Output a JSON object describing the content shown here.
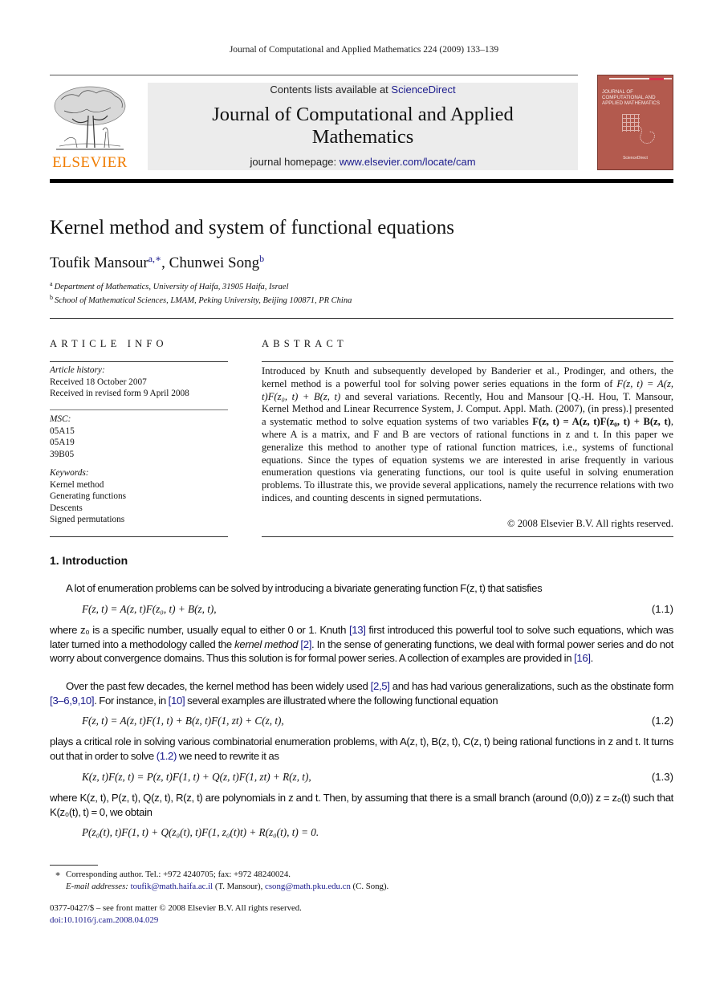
{
  "running_head": "Journal of Computational and Applied Mathematics 224 (2009) 133–139",
  "publisher": {
    "logo_word": "ELSEVIER",
    "logo_color": "#f07c00",
    "contents_prefix": "Contents lists available at ",
    "contents_link": "ScienceDirect",
    "journal_title_line1": "Journal of Computational and Applied",
    "journal_title_line2": "Mathematics",
    "homepage_prefix": "journal homepage: ",
    "homepage_link": "www.elsevier.com/locate/cam",
    "link_color": "#1a1a8c",
    "cover": {
      "title": "JOURNAL OF COMPUTATIONAL AND APPLIED MATHEMATICS",
      "footer": "ScienceDirect",
      "color": "#b35a4e"
    }
  },
  "article": {
    "title": "Kernel method and system of functional equations",
    "authors": [
      {
        "name": "Toufik Mansour",
        "marks": "a,∗"
      },
      {
        "name": "Chunwei Song",
        "marks": "b"
      }
    ],
    "author_separator": ", ",
    "affiliations": [
      {
        "mark": "a",
        "text": "Department of Mathematics, University of Haifa, 31905 Haifa, Israel"
      },
      {
        "mark": "b",
        "text": "School of Mathematical Sciences, LMAM, Peking University, Beijing 100871, PR China"
      }
    ]
  },
  "article_info": {
    "heading": "ARTICLE INFO",
    "history_label": "Article history:",
    "history": [
      "Received 18 October 2007",
      "Received in revised form 9 April 2008"
    ],
    "msc_label": "MSC:",
    "msc": [
      "05A15",
      "05A19",
      "39B05"
    ],
    "keywords_label": "Keywords:",
    "keywords": [
      "Kernel method",
      "Generating functions",
      "Descents",
      "Signed permutations"
    ]
  },
  "abstract": {
    "heading": "ABSTRACT",
    "p1": "Introduced by Knuth and subsequently developed by Banderier et al., Prodinger, and others, the kernel method is a powerful tool for solving power series equations in the form of ",
    "eq1": "F(z, t) = A(z, t)F(z₀, t) + B(z, t)",
    "p2": " and several variations. Recently, Hou and Mansour [Q.-H. Hou, T. Mansour, Kernel Method and Linear Recurrence System, J. Comput. Appl. Math. (2007), (in press).] presented a systematic method to solve equation systems of two variables ",
    "eq2": "F(z, t) = A(z, t)F(z₀, t) + B(z, t)",
    "p3": ", where A is a matrix, and F and B are vectors of rational functions in z and t. In this paper we generalize this method to another type of rational function matrices, i.e., systems of functional equations. Since the types of equation systems we are interested in arise frequently in various enumeration questions via generating functions, our tool is quite useful in solving enumeration problems. To illustrate this, we provide several applications, namely the recurrence relations with two indices, and counting descents in signed permutations.",
    "copyright": "© 2008 Elsevier B.V. All rights reserved."
  },
  "introduction": {
    "heading": "1.  Introduction",
    "para1": "A lot of enumeration problems can be solved by introducing a bivariate generating function F(z, t) that satisfies",
    "eq_1_1": "F(z, t) = A(z, t)F(z₀, t) + B(z, t),",
    "eq_1_1_num": "(1.1)",
    "para2_a": "where z₀ is a specific number, usually equal to either 0 or 1. Knuth ",
    "ref_13": "[13]",
    "para2_b": " first introduced this powerful tool to solve such equations, which was later turned into a methodology called the ",
    "para2_em": "kernel method",
    "ref_2": "[2]",
    "para2_c": ". In the sense of generating functions, we deal with formal power series and do not worry about convergence domains. Thus this solution is for formal power series. A collection of examples are provided in ",
    "ref_16": "[16]",
    "para2_d": ".",
    "para3_a": "Over the past few decades, the kernel method has been widely used ",
    "ref_2_5": "[2,5]",
    "para3_b": " and has had various generalizations, such as the obstinate form ",
    "ref_3_10": "[3–6,9,10]",
    "para3_c": ". For instance, in ",
    "ref_10": "[10]",
    "para3_d": " several examples are illustrated where the following functional equation",
    "eq_1_2": "F(z, t) = A(z, t)F(1, t) + B(z, t)F(1, zt) + C(z, t),",
    "eq_1_2_num": "(1.2)",
    "para4_a": "plays a critical role in solving various combinatorial enumeration problems, with A(z, t), B(z, t), C(z, t) being rational functions in z and t. It turns out that in order to solve ",
    "ref_eq_1_2": "(1.2)",
    "para4_b": " we need to rewrite it as",
    "eq_1_3": "K(z, t)F(z, t) = P(z, t)F(1, t) + Q(z, t)F(1, zt) + R(z, t),",
    "eq_1_3_num": "(1.3)",
    "para5": "where K(z, t), P(z, t), Q(z, t), R(z, t) are polynomials in z and t. Then, by assuming that there is a small branch (around (0,0)) z = z₀(t) such that K(z₀(t), t) = 0, we obtain",
    "eq_final": "P(z₀(t), t)F(1, t) + Q(z₀(t), t)F(1, z₀(t)t) + R(z₀(t), t) = 0."
  },
  "footnotes": {
    "star": "∗",
    "corresponding": "Corresponding author. Tel.: +972 4240705; fax: +972 48240024.",
    "email_label": "E-mail addresses: ",
    "email1": "toufik@math.haifa.ac.il",
    "email1_owner": " (T. Mansour), ",
    "email2": "csong@math.pku.edu.cn",
    "email2_owner": " (C. Song).",
    "issn_line": "0377-0427/$ – see front matter © 2008 Elsevier B.V. All rights reserved.",
    "doi": "doi:10.1016/j.cam.2008.04.029"
  }
}
